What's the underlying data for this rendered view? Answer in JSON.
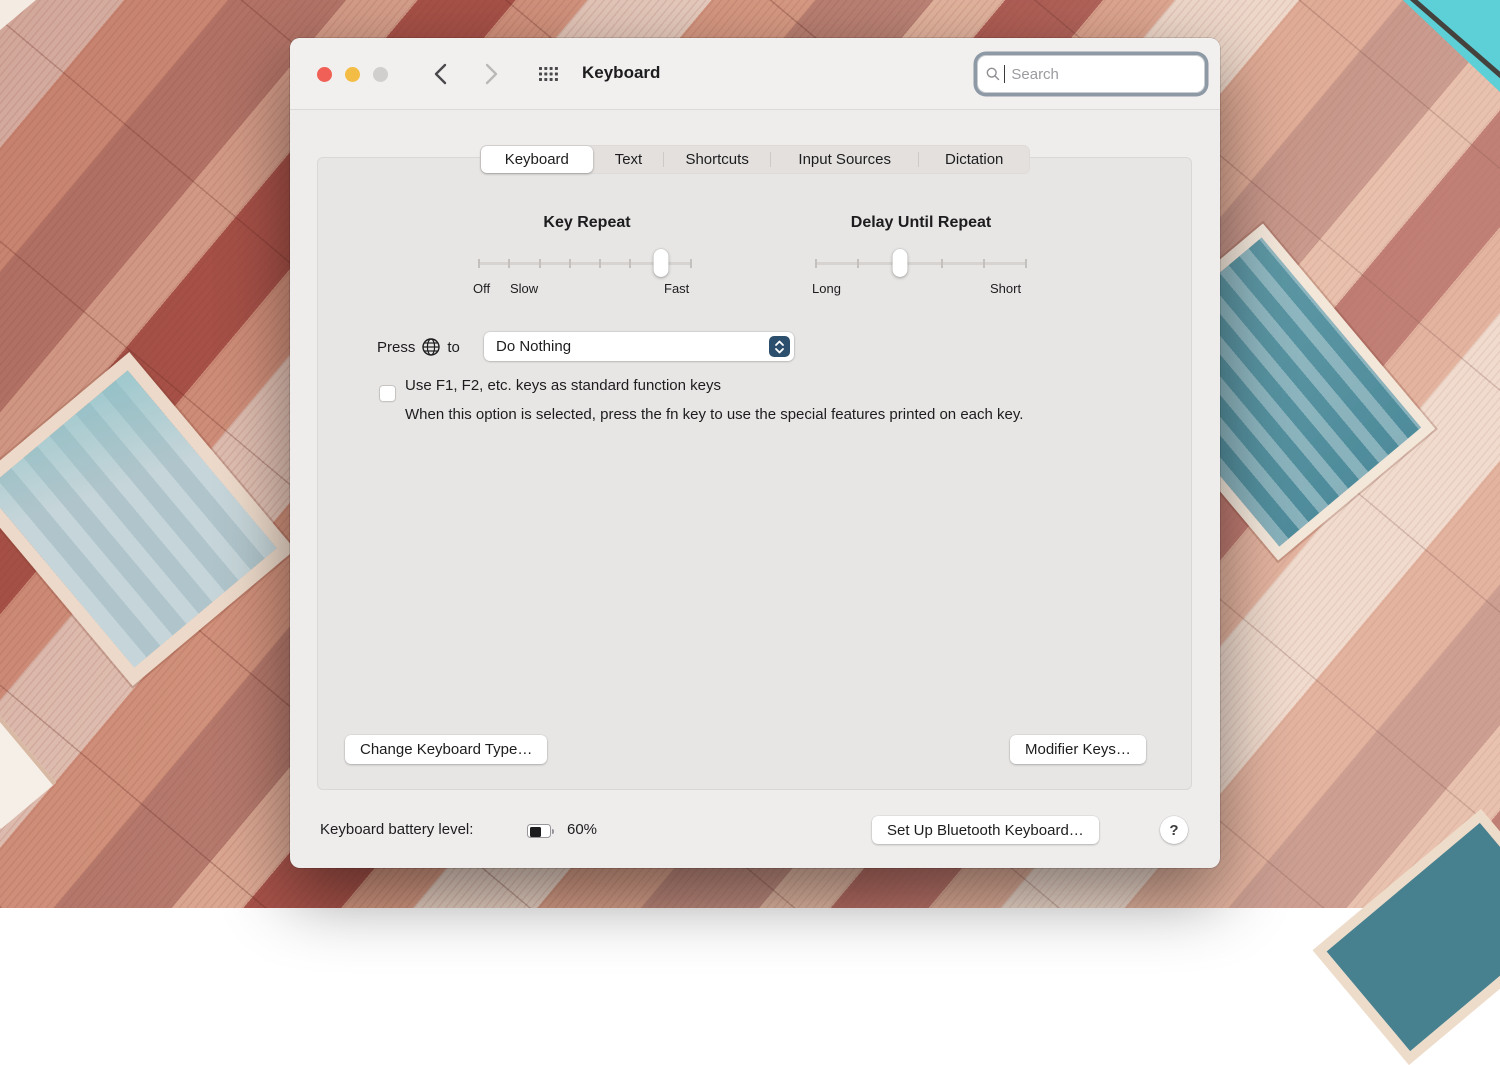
{
  "titlebar": {
    "title": "Keyboard",
    "search_placeholder": "Search"
  },
  "tabs": [
    {
      "label": "Keyboard",
      "selected": true
    },
    {
      "label": "Text",
      "selected": false
    },
    {
      "label": "Shortcuts",
      "selected": false
    },
    {
      "label": "Input Sources",
      "selected": false
    },
    {
      "label": "Dictation",
      "selected": false
    }
  ],
  "panel": {
    "key_repeat": {
      "title": "Key Repeat",
      "tick_count": 8,
      "value_index": 7,
      "label_off": "Off",
      "label_slow": "Slow",
      "label_fast": "Fast"
    },
    "delay_until_repeat": {
      "title": "Delay Until Repeat",
      "tick_count": 6,
      "value_index": 3,
      "label_long": "Long",
      "label_short": "Short"
    },
    "globe_key_row": {
      "prefix": "Press",
      "suffix": "to",
      "selected_option": "Do Nothing"
    },
    "function_keys": {
      "checkbox_label": "Use F1, F2, etc. keys as standard function keys",
      "checked": false,
      "description": "When this option is selected, press the fn key to use the special features printed on each key."
    },
    "change_keyboard_type_label": "Change Keyboard Type…",
    "modifier_keys_label": "Modifier Keys…"
  },
  "footer": {
    "battery_label": "Keyboard battery level:",
    "battery_percent": "60%",
    "battery_fill": 60,
    "bluetooth_button_label": "Set Up Bluetooth Keyboard…",
    "help_label": "?"
  },
  "icons": {
    "search": "magnifier",
    "back": "chevron-left",
    "forward": "chevron-right",
    "launchpad": "grid-dots",
    "globe": "globe",
    "popup_stepper": "up-down-chevrons",
    "battery": "battery-indicator",
    "help": "question-mark"
  },
  "colors": {
    "traffic_red": "#f16056",
    "traffic_yellow": "#f3bd45",
    "traffic_gray": "#d1cfcd",
    "focus_ring": "#8d99a5",
    "popup_accent": "#2d4f6e",
    "sky": "#5dcfd6",
    "facade_cream": "#ead3c5",
    "facade_salmon": "#d89c85",
    "facade_mauve": "#b98073",
    "facade_peach": "#e0b09a",
    "facade_brick": "#a9544b",
    "c_content": "#efedec",
    "c_panel": "#e8e6e4",
    "c_seg": "#e3e0de"
  }
}
